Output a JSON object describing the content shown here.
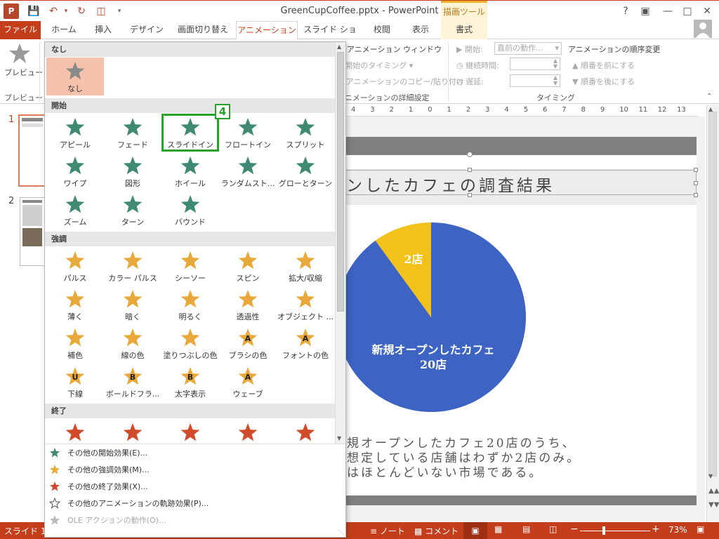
{
  "window": {
    "title": "GreenCupCoffee.pptx - PowerPoint",
    "context_tab_group": "描画ツール",
    "help": "?"
  },
  "tabs": [
    "ファイル",
    "ホーム",
    "挿入",
    "デザイン",
    "画面切り替え",
    "アニメーション",
    "スライド ショー",
    "校閲",
    "表示",
    "書式"
  ],
  "ribbon": {
    "preview_label": "プレビュー",
    "preview_group": "プレビュー",
    "animation_pane": "アニメーション ウィンドウ",
    "trigger": "開始のタイミング",
    "painter": "アニメーションのコピー/貼り付け",
    "advanced_group": "アニメーションの詳細設定",
    "start_label": "開始:",
    "start_value": "直前の動作...",
    "duration_label": "継続時間:",
    "delay_label": "遅延:",
    "timing_group": "タイミング",
    "reorder_title": "アニメーションの順序変更",
    "move_earlier": "順番を前にする",
    "move_later": "順番を後にする"
  },
  "thumbnails": [
    {
      "number": "1",
      "selected": true
    },
    {
      "number": "2",
      "selected": false
    }
  ],
  "ruler_ticks": [
    "4",
    "3",
    "2",
    "1",
    "0",
    "1",
    "2",
    "3",
    "4",
    "5",
    "6",
    "7",
    "8",
    "9",
    "10",
    "11",
    "12",
    "13"
  ],
  "slide": {
    "title_visible": "ンしたカフェの調査結果",
    "body_lines": [
      "規オープンしたカフェ20店のうち、",
      "想定している店舗はわずか2店のみ。",
      "はほとんどいない市場である。"
    ]
  },
  "chart_data": {
    "type": "pie",
    "categories": [
      "新規オープンしたカフェ\n20店",
      "2店"
    ],
    "values": [
      18,
      2
    ],
    "labels": [
      "新規オープンしたカフェ",
      "20店",
      "2店"
    ],
    "colors": [
      "#3d64c2",
      "#f2c21a"
    ]
  },
  "gallery": {
    "sections": [
      {
        "title": "なし",
        "items": [
          {
            "label": "なし",
            "icon": "none-star-icon"
          }
        ]
      },
      {
        "title": "開始",
        "items": [
          {
            "label": "アピール",
            "icon": "appear-icon"
          },
          {
            "label": "フェード",
            "icon": "fade-icon"
          },
          {
            "label": "スライドイン",
            "icon": "fly-in-icon"
          },
          {
            "label": "フロートイン",
            "icon": "float-in-icon"
          },
          {
            "label": "スプリット",
            "icon": "split-icon"
          },
          {
            "label": "ワイプ",
            "icon": "wipe-icon"
          },
          {
            "label": "図形",
            "icon": "shape-icon"
          },
          {
            "label": "ホイール",
            "icon": "wheel-icon"
          },
          {
            "label": "ランダムスト...",
            "icon": "random-bars-icon"
          },
          {
            "label": "グローとターン",
            "icon": "grow-turn-icon"
          },
          {
            "label": "ズーム",
            "icon": "zoom-icon"
          },
          {
            "label": "ターン",
            "icon": "swivel-icon"
          },
          {
            "label": "バウンド",
            "icon": "bounce-icon"
          }
        ]
      },
      {
        "title": "強調",
        "items": [
          {
            "label": "パルス",
            "icon": "pulse-icon"
          },
          {
            "label": "カラー パルス",
            "icon": "color-pulse-icon"
          },
          {
            "label": "シーソー",
            "icon": "teeter-icon"
          },
          {
            "label": "スピン",
            "icon": "spin-icon"
          },
          {
            "label": "拡大/収縮",
            "icon": "grow-shrink-icon"
          },
          {
            "label": "薄く",
            "icon": "desaturate-icon"
          },
          {
            "label": "暗く",
            "icon": "darken-icon"
          },
          {
            "label": "明るく",
            "icon": "lighten-icon"
          },
          {
            "label": "透過性",
            "icon": "transparency-icon"
          },
          {
            "label": "オブジェクト ...",
            "icon": "object-color-icon"
          },
          {
            "label": "補色",
            "icon": "complementary-color-icon"
          },
          {
            "label": "線の色",
            "icon": "line-color-icon"
          },
          {
            "label": "塗りつぶしの色",
            "icon": "fill-color-icon"
          },
          {
            "label": "ブラシの色",
            "icon": "brush-color-icon"
          },
          {
            "label": "フォントの色",
            "icon": "font-color-icon"
          },
          {
            "label": "下線",
            "icon": "underline-icon"
          },
          {
            "label": "ボールドフラ...",
            "icon": "bold-flash-icon"
          },
          {
            "label": "太字表示",
            "icon": "bold-reveal-icon"
          },
          {
            "label": "ウェーブ",
            "icon": "wave-icon"
          }
        ]
      },
      {
        "title": "終了",
        "items": [
          {
            "label": "",
            "icon": "exit-disappear-icon"
          },
          {
            "label": "",
            "icon": "exit-fade-icon"
          },
          {
            "label": "",
            "icon": "exit-fly-out-icon"
          },
          {
            "label": "",
            "icon": "exit-float-out-icon"
          },
          {
            "label": "",
            "icon": "exit-split-icon"
          }
        ]
      }
    ],
    "badge": "4",
    "menu": [
      {
        "label": "その他の開始効果(E)...",
        "icon": "entrance-star-icon",
        "enabled": true
      },
      {
        "label": "その他の強調効果(M)...",
        "icon": "emphasis-star-icon",
        "enabled": true
      },
      {
        "label": "その他の終了効果(X)...",
        "icon": "exit-star-icon",
        "enabled": true
      },
      {
        "label": "その他のアニメーションの軌跡効果(P)...",
        "icon": "motion-path-icon",
        "enabled": true
      },
      {
        "label": "OLE アクションの動作(O)...",
        "icon": "ole-action-icon",
        "enabled": false
      }
    ]
  },
  "statusbar": {
    "slide_info": "スライド 1/2",
    "notes": "ノート",
    "comments": "コメント",
    "zoom": "73%"
  },
  "colors": {
    "accent": "#c43e1c",
    "entrance": "#3e8a73",
    "emphasis": "#e8a93a",
    "exit": "#cf4b2c",
    "highlight_badge": "#2aa12a"
  }
}
